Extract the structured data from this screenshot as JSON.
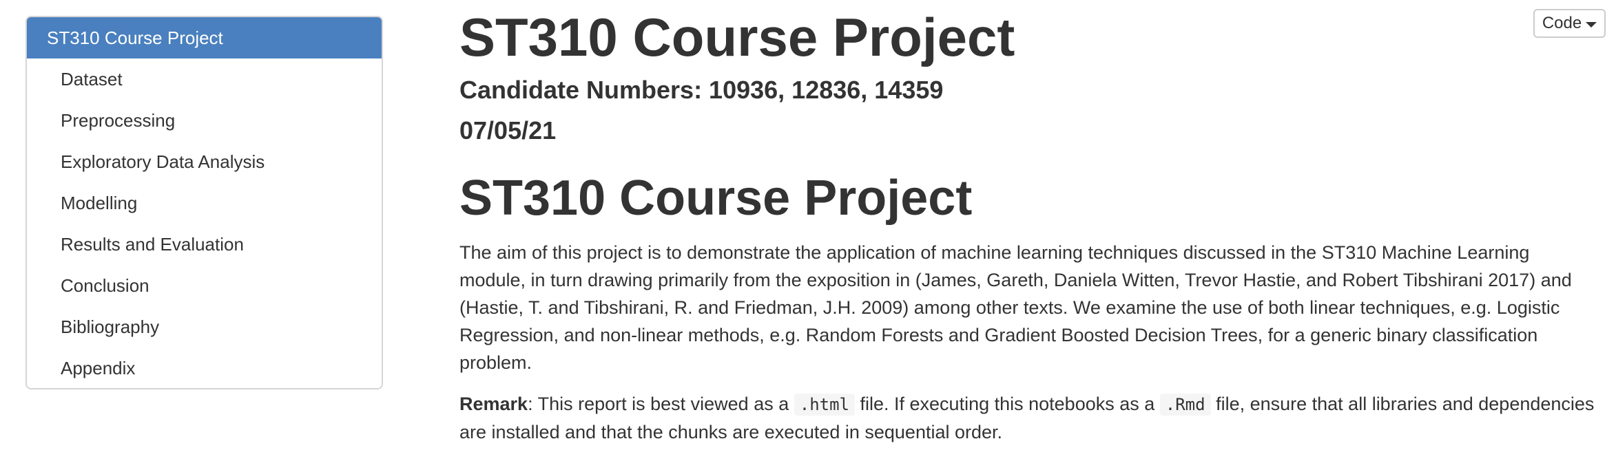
{
  "toc": {
    "items": [
      {
        "label": "ST310 Course Project"
      },
      {
        "label": "Dataset"
      },
      {
        "label": "Preprocessing"
      },
      {
        "label": "Exploratory Data Analysis"
      },
      {
        "label": "Modelling"
      },
      {
        "label": "Results and Evaluation"
      },
      {
        "label": "Conclusion"
      },
      {
        "label": "Bibliography"
      },
      {
        "label": "Appendix"
      }
    ],
    "active_index": 0
  },
  "code_button": {
    "label": "Code",
    "icon": "caret-down-icon"
  },
  "document": {
    "title": "ST310 Course Project",
    "subtitle": "Candidate Numbers: 10936, 12836, 14359",
    "date": "07/05/21",
    "section_title": "ST310 Course Project",
    "intro_paragraph": "The aim of this project is to demonstrate the application of machine learning techniques discussed in the ST310 Machine Learning module, in turn drawing primarily from the exposition in (James, Gareth, Daniela Witten, Trevor Hastie, and Robert Tibshirani 2017) and (Hastie, T. and Tibshirani, R. and Friedman, J.H. 2009) among other texts. We examine the use of both linear techniques, e.g. Logistic Regression, and non-linear methods, e.g. Random Forests and Gradient Boosted Decision Trees, for a generic binary classification problem.",
    "remark": {
      "label": "Remark",
      "text_1": ": This report is best viewed as a ",
      "code_1": ".html",
      "text_2": " file. If executing this notebooks as a ",
      "code_2": ".Rmd",
      "text_3": " file, ensure that all libraries and dependencies are installed and that the chunks are executed in sequential order."
    }
  },
  "colors": {
    "accent": "#4a80bf",
    "text": "#333333",
    "border": "#d6d6d6",
    "code_bg": "#f5f5f5"
  }
}
